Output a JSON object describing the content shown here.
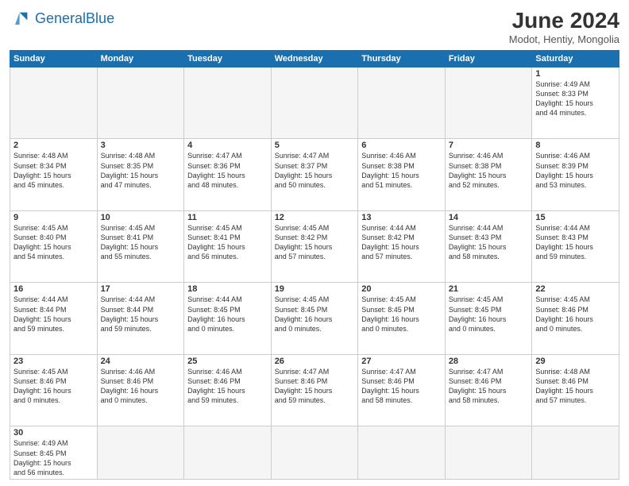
{
  "header": {
    "logo_general": "General",
    "logo_blue": "Blue",
    "title": "June 2024",
    "subtitle": "Modot, Hentiy, Mongolia"
  },
  "weekdays": [
    "Sunday",
    "Monday",
    "Tuesday",
    "Wednesday",
    "Thursday",
    "Friday",
    "Saturday"
  ],
  "weeks": [
    [
      {
        "day": null,
        "info": null
      },
      {
        "day": null,
        "info": null
      },
      {
        "day": null,
        "info": null
      },
      {
        "day": null,
        "info": null
      },
      {
        "day": null,
        "info": null
      },
      {
        "day": null,
        "info": null
      },
      {
        "day": "1",
        "info": "Sunrise: 4:49 AM\nSunset: 8:33 PM\nDaylight: 15 hours\nand 44 minutes."
      }
    ],
    [
      {
        "day": "2",
        "info": "Sunrise: 4:48 AM\nSunset: 8:34 PM\nDaylight: 15 hours\nand 45 minutes."
      },
      {
        "day": "3",
        "info": "Sunrise: 4:48 AM\nSunset: 8:35 PM\nDaylight: 15 hours\nand 47 minutes."
      },
      {
        "day": "4",
        "info": "Sunrise: 4:47 AM\nSunset: 8:36 PM\nDaylight: 15 hours\nand 48 minutes."
      },
      {
        "day": "5",
        "info": "Sunrise: 4:47 AM\nSunset: 8:37 PM\nDaylight: 15 hours\nand 50 minutes."
      },
      {
        "day": "6",
        "info": "Sunrise: 4:46 AM\nSunset: 8:38 PM\nDaylight: 15 hours\nand 51 minutes."
      },
      {
        "day": "7",
        "info": "Sunrise: 4:46 AM\nSunset: 8:38 PM\nDaylight: 15 hours\nand 52 minutes."
      },
      {
        "day": "8",
        "info": "Sunrise: 4:46 AM\nSunset: 8:39 PM\nDaylight: 15 hours\nand 53 minutes."
      }
    ],
    [
      {
        "day": "9",
        "info": "Sunrise: 4:45 AM\nSunset: 8:40 PM\nDaylight: 15 hours\nand 54 minutes."
      },
      {
        "day": "10",
        "info": "Sunrise: 4:45 AM\nSunset: 8:41 PM\nDaylight: 15 hours\nand 55 minutes."
      },
      {
        "day": "11",
        "info": "Sunrise: 4:45 AM\nSunset: 8:41 PM\nDaylight: 15 hours\nand 56 minutes."
      },
      {
        "day": "12",
        "info": "Sunrise: 4:45 AM\nSunset: 8:42 PM\nDaylight: 15 hours\nand 57 minutes."
      },
      {
        "day": "13",
        "info": "Sunrise: 4:44 AM\nSunset: 8:42 PM\nDaylight: 15 hours\nand 57 minutes."
      },
      {
        "day": "14",
        "info": "Sunrise: 4:44 AM\nSunset: 8:43 PM\nDaylight: 15 hours\nand 58 minutes."
      },
      {
        "day": "15",
        "info": "Sunrise: 4:44 AM\nSunset: 8:43 PM\nDaylight: 15 hours\nand 59 minutes."
      }
    ],
    [
      {
        "day": "16",
        "info": "Sunrise: 4:44 AM\nSunset: 8:44 PM\nDaylight: 15 hours\nand 59 minutes."
      },
      {
        "day": "17",
        "info": "Sunrise: 4:44 AM\nSunset: 8:44 PM\nDaylight: 15 hours\nand 59 minutes."
      },
      {
        "day": "18",
        "info": "Sunrise: 4:44 AM\nSunset: 8:45 PM\nDaylight: 16 hours\nand 0 minutes."
      },
      {
        "day": "19",
        "info": "Sunrise: 4:45 AM\nSunset: 8:45 PM\nDaylight: 16 hours\nand 0 minutes."
      },
      {
        "day": "20",
        "info": "Sunrise: 4:45 AM\nSunset: 8:45 PM\nDaylight: 16 hours\nand 0 minutes."
      },
      {
        "day": "21",
        "info": "Sunrise: 4:45 AM\nSunset: 8:45 PM\nDaylight: 16 hours\nand 0 minutes."
      },
      {
        "day": "22",
        "info": "Sunrise: 4:45 AM\nSunset: 8:46 PM\nDaylight: 16 hours\nand 0 minutes."
      }
    ],
    [
      {
        "day": "23",
        "info": "Sunrise: 4:45 AM\nSunset: 8:46 PM\nDaylight: 16 hours\nand 0 minutes."
      },
      {
        "day": "24",
        "info": "Sunrise: 4:46 AM\nSunset: 8:46 PM\nDaylight: 16 hours\nand 0 minutes."
      },
      {
        "day": "25",
        "info": "Sunrise: 4:46 AM\nSunset: 8:46 PM\nDaylight: 15 hours\nand 59 minutes."
      },
      {
        "day": "26",
        "info": "Sunrise: 4:47 AM\nSunset: 8:46 PM\nDaylight: 15 hours\nand 59 minutes."
      },
      {
        "day": "27",
        "info": "Sunrise: 4:47 AM\nSunset: 8:46 PM\nDaylight: 15 hours\nand 58 minutes."
      },
      {
        "day": "28",
        "info": "Sunrise: 4:47 AM\nSunset: 8:46 PM\nDaylight: 15 hours\nand 58 minutes."
      },
      {
        "day": "29",
        "info": "Sunrise: 4:48 AM\nSunset: 8:46 PM\nDaylight: 15 hours\nand 57 minutes."
      }
    ],
    [
      {
        "day": "30",
        "info": "Sunrise: 4:49 AM\nSunset: 8:45 PM\nDaylight: 15 hours\nand 56 minutes."
      },
      {
        "day": null,
        "info": null
      },
      {
        "day": null,
        "info": null
      },
      {
        "day": null,
        "info": null
      },
      {
        "day": null,
        "info": null
      },
      {
        "day": null,
        "info": null
      },
      {
        "day": null,
        "info": null
      }
    ]
  ]
}
